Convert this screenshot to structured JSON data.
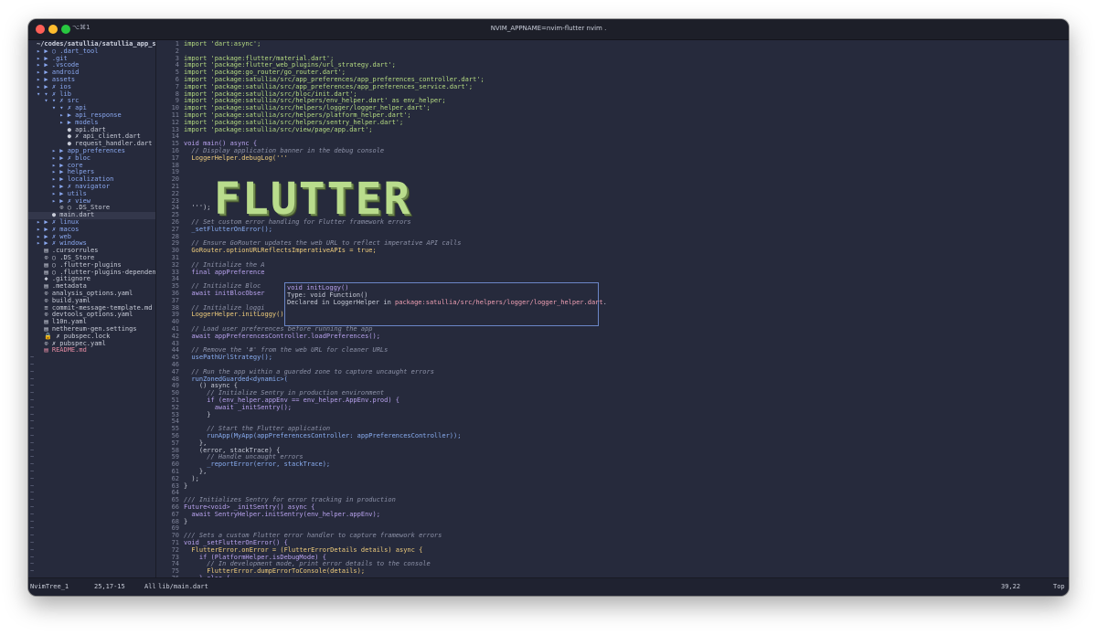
{
  "window": {
    "shortcut": "⌥⌘1",
    "title": "NVIM_APPNAME=nvim-flutter nvim ."
  },
  "tree": {
    "root": "~/codes/satullia/satullia_app_sta",
    "entries": [
      {
        "text": "▸ ▶ ○ .dart_tool",
        "kind": "dir"
      },
      {
        "text": "▸ ▶ .git",
        "kind": "dir"
      },
      {
        "text": "▸ ▶ .vscode",
        "kind": "dir"
      },
      {
        "text": "▸ ▶ android",
        "kind": "dir"
      },
      {
        "text": "▸ ▶ assets",
        "kind": "dir"
      },
      {
        "text": "▸ ▶ ✗ ios",
        "kind": "dir"
      },
      {
        "text": "▾ ▾ ✗ lib",
        "kind": "dir"
      },
      {
        "text": "  ▾ ▾ ✗ src",
        "kind": "dir"
      },
      {
        "text": "    ▾ ▾ ✗ api",
        "kind": "dir"
      },
      {
        "text": "      ▸ ▶ api_response",
        "kind": "dir"
      },
      {
        "text": "      ▸ ▶ models",
        "kind": "dir"
      },
      {
        "text": "        ● api.dart",
        "kind": "file"
      },
      {
        "text": "        ● ✗ api_client.dart",
        "kind": "file"
      },
      {
        "text": "        ● request_handler.dart",
        "kind": "file"
      },
      {
        "text": "    ▸ ▶ app_preferences",
        "kind": "dir"
      },
      {
        "text": "    ▸ ▶ ✗ bloc",
        "kind": "dir"
      },
      {
        "text": "    ▸ ▶ core",
        "kind": "dir"
      },
      {
        "text": "    ▸ ▶ helpers",
        "kind": "dir"
      },
      {
        "text": "    ▸ ▶ localization",
        "kind": "dir"
      },
      {
        "text": "    ▸ ▶ ✗ navigator",
        "kind": "dir"
      },
      {
        "text": "    ▸ ▶ utils",
        "kind": "dir"
      },
      {
        "text": "    ▸ ▶ ✗ view",
        "kind": "dir"
      },
      {
        "text": "      ⊙ ○ .DS_Store",
        "kind": "file"
      },
      {
        "text": "    ● main.dart",
        "kind": "file",
        "highlight": true
      },
      {
        "text": "▸ ▶ ✗ linux",
        "kind": "dir"
      },
      {
        "text": "▸ ▶ ✗ macos",
        "kind": "dir"
      },
      {
        "text": "▸ ▶ ✗ web",
        "kind": "dir"
      },
      {
        "text": "▸ ▶ ✗ windows",
        "kind": "dir"
      },
      {
        "text": "  ▤ .cursorrules",
        "kind": "file"
      },
      {
        "text": "  ⊙ ○ .DS_Store",
        "kind": "file"
      },
      {
        "text": "  ▤ ○ .flutter-plugins",
        "kind": "file"
      },
      {
        "text": "  ▤ ○ .flutter-plugins-dependenci",
        "kind": "file"
      },
      {
        "text": "  ◆ .gitignore",
        "kind": "file"
      },
      {
        "text": "  ▤ .metadata",
        "kind": "file"
      },
      {
        "text": "  ⊙ analysis_options.yaml",
        "kind": "file"
      },
      {
        "text": "  ⊙ build.yaml",
        "kind": "file"
      },
      {
        "text": "  ≡ commit-message-template.md",
        "kind": "file"
      },
      {
        "text": "  ⊙ devtools_options.yaml",
        "kind": "file"
      },
      {
        "text": "  ▤ l10n.yaml",
        "kind": "file"
      },
      {
        "text": "  ▤ nethereum-gen.settings",
        "kind": "file"
      },
      {
        "text": "  🔒 ✗ pubspec.lock",
        "kind": "file"
      },
      {
        "text": "  ⊙ ✗ pubspec.yaml",
        "kind": "file"
      },
      {
        "text": "  ▤ README.md",
        "kind": "readme"
      }
    ],
    "tildes": [
      "~",
      "~",
      "~",
      "~",
      "~",
      "~",
      "~",
      "~",
      "~",
      "~",
      "~",
      "~",
      "~",
      "~",
      "~",
      "~",
      "~",
      "~",
      "~",
      "~",
      "~",
      "~",
      "~",
      "~",
      "~",
      "~",
      "~",
      "~",
      "~",
      "~",
      "~"
    ]
  },
  "editor": {
    "banner": "FLUTTER",
    "lines": [
      {
        "n": "1",
        "t": "import 'dart:async';"
      },
      {
        "n": "2",
        "t": ""
      },
      {
        "n": "3",
        "t": "import 'package:flutter/material.dart';"
      },
      {
        "n": "4",
        "t": "import 'package:flutter_web_plugins/url_strategy.dart';"
      },
      {
        "n": "5",
        "t": "import 'package:go_router/go_router.dart';"
      },
      {
        "n": "6",
        "t": "import 'package:satullia/src/app_preferences/app_preferences_controller.dart';"
      },
      {
        "n": "7",
        "t": "import 'package:satullia/src/app_preferences/app_preferences_service.dart';"
      },
      {
        "n": "8",
        "t": "import 'package:satullia/src/bloc/init.dart';"
      },
      {
        "n": "9",
        "t": "import 'package:satullia/src/helpers/env_helper.dart' as env_helper;"
      },
      {
        "n": "10",
        "t": "import 'package:satullia/src/helpers/logger/logger_helper.dart';"
      },
      {
        "n": "11",
        "t": "import 'package:satullia/src/helpers/platform_helper.dart';"
      },
      {
        "n": "12",
        "t": "import 'package:satullia/src/helpers/sentry_helper.dart';"
      },
      {
        "n": "13",
        "t": "import 'package:satullia/src/view/page/app.dart';"
      },
      {
        "n": "14",
        "t": ""
      },
      {
        "n": "15",
        "t": "void main() async {"
      },
      {
        "n": "16",
        "t": "  // Display application banner in the debug console"
      },
      {
        "n": "17",
        "t": "  LoggerHelper.debugLog('''"
      },
      {
        "n": "18",
        "t": ""
      },
      {
        "n": "19",
        "t": ""
      },
      {
        "n": "20",
        "t": ""
      },
      {
        "n": "21",
        "t": ""
      },
      {
        "n": "22",
        "t": ""
      },
      {
        "n": "23",
        "t": ""
      },
      {
        "n": "24",
        "t": "  ''');"
      },
      {
        "n": "25",
        "t": ""
      },
      {
        "n": "26",
        "t": "  // Set custom error handling for Flutter framework errors"
      },
      {
        "n": "27",
        "t": "  _setFlutterOnError();"
      },
      {
        "n": "28",
        "t": ""
      },
      {
        "n": "29",
        "t": "  // Ensure GoRouter updates the web URL to reflect imperative API calls"
      },
      {
        "n": "30",
        "t": "  GoRouter.optionURLReflectsImperativeAPIs = true;"
      },
      {
        "n": "31",
        "t": ""
      },
      {
        "n": "32",
        "t": "  // Initialize the A"
      },
      {
        "n": "33",
        "t": "  final appPreference"
      },
      {
        "n": "34",
        "t": ""
      },
      {
        "n": "35",
        "t": "  // Initialize Bloc"
      },
      {
        "n": "36",
        "t": "  await initBlocObser"
      },
      {
        "n": "37",
        "t": ""
      },
      {
        "n": "38",
        "t": "  // Initialize loggi"
      },
      {
        "n": "39",
        "t": "  LoggerHelper.initLoggy();"
      },
      {
        "n": "40",
        "t": ""
      },
      {
        "n": "41",
        "t": "  // Load user preferences before running the app"
      },
      {
        "n": "42",
        "t": "  await appPreferencesController.loadPreferences();"
      },
      {
        "n": "43",
        "t": ""
      },
      {
        "n": "44",
        "t": "  // Remove the '#' from the web URL for cleaner URLs"
      },
      {
        "n": "45",
        "t": "  usePathUrlStrategy();"
      },
      {
        "n": "46",
        "t": ""
      },
      {
        "n": "47",
        "t": "  // Run the app within a guarded zone to capture uncaught errors"
      },
      {
        "n": "48",
        "t": "  runZonedGuarded<dynamic>("
      },
      {
        "n": "49",
        "t": "    () async {"
      },
      {
        "n": "50",
        "t": "      // Initialize Sentry in production environment"
      },
      {
        "n": "51",
        "t": "      if (env_helper.appEnv == env_helper.AppEnv.prod) {"
      },
      {
        "n": "52",
        "t": "        await _initSentry();"
      },
      {
        "n": "53",
        "t": "      }"
      },
      {
        "n": "54",
        "t": ""
      },
      {
        "n": "55",
        "t": "      // Start the Flutter application"
      },
      {
        "n": "56",
        "t": "      runApp(MyApp(appPreferencesController: appPreferencesController));"
      },
      {
        "n": "57",
        "t": "    },"
      },
      {
        "n": "58",
        "t": "    (error, stackTrace) {"
      },
      {
        "n": "59",
        "t": "      // Handle uncaught errors"
      },
      {
        "n": "60",
        "t": "      _reportError(error, stackTrace);"
      },
      {
        "n": "61",
        "t": "    },"
      },
      {
        "n": "62",
        "t": "  );"
      },
      {
        "n": "63",
        "t": "}"
      },
      {
        "n": "64",
        "t": ""
      },
      {
        "n": "65",
        "t": "/// Initializes Sentry for error tracking in production"
      },
      {
        "n": "66",
        "t": "Future<void> _initSentry() async {"
      },
      {
        "n": "67",
        "t": "  await SentryHelper.initSentry(env_helper.appEnv);"
      },
      {
        "n": "68",
        "t": "}"
      },
      {
        "n": "69",
        "t": ""
      },
      {
        "n": "70",
        "t": "/// Sets a custom Flutter error handler to capture framework errors"
      },
      {
        "n": "71",
        "t": "void _setFlutterOnError() {"
      },
      {
        "n": "72",
        "t": "  FlutterError.onError = (FlutterErrorDetails details) async {"
      },
      {
        "n": "73",
        "t": "    if (PlatformHelper.isDebugMode) {"
      },
      {
        "n": "74",
        "t": "      // In development mode, print error details to the console"
      },
      {
        "n": "75",
        "t": "      FlutterError.dumpErrorToConsole(details);"
      },
      {
        "n": "76",
        "t": "    } else {"
      }
    ]
  },
  "hover": {
    "line1": "void initLoggy()",
    "line2": "Type: void Function()",
    "line3_prefix": "Declared in LoggerHelper in ",
    "line3_path": "package:satullia/src/helpers/logger/logger_helper.dart",
    "line3_suffix": "."
  },
  "status": {
    "tree_name": "NvimTree_1",
    "tree_pos": "25,17-15",
    "tree_all": "All",
    "file": "lib/main.dart",
    "cursor": "39,22",
    "scroll": "Top"
  },
  "colors": {
    "background": "#262a3c",
    "directory": "#8aa8f0",
    "string": "#b6dc82",
    "keyword": "#b9a3ef",
    "class": "#f0cd7c",
    "hover_border": "#6b86c7"
  }
}
